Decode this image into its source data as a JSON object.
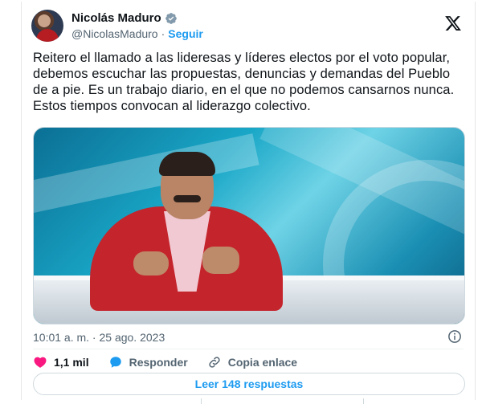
{
  "author": {
    "name": "Nicolás Maduro",
    "handle": "@NicolasMaduro",
    "separator": "·",
    "follow_label": "Seguir"
  },
  "tweet": {
    "text": "Reitero el llamado a las lideresas y líderes electos por el voto popular, debemos escuchar las propuestas, denuncias y demandas del Pueblo de a pie. Es un trabajo diario, en el que no podemos cansarnos nunca. Estos tiempos convocan al liderazgo colectivo.",
    "timestamp": "10:01 a. m. · 25 ago. 2023"
  },
  "actions": {
    "likes": "1,1 mil",
    "reply_label": "Responder",
    "copy_label": "Copia enlace"
  },
  "read_replies_label": "Leer 148 respuestas",
  "colors": {
    "accent": "#1d9bf0",
    "heart": "#f91880",
    "text": "#0f1419",
    "muted": "#536471"
  },
  "icons": [
    "verified-badge-icon",
    "x-logo-icon",
    "info-icon",
    "heart-icon",
    "reply-bubble-icon",
    "link-icon"
  ]
}
